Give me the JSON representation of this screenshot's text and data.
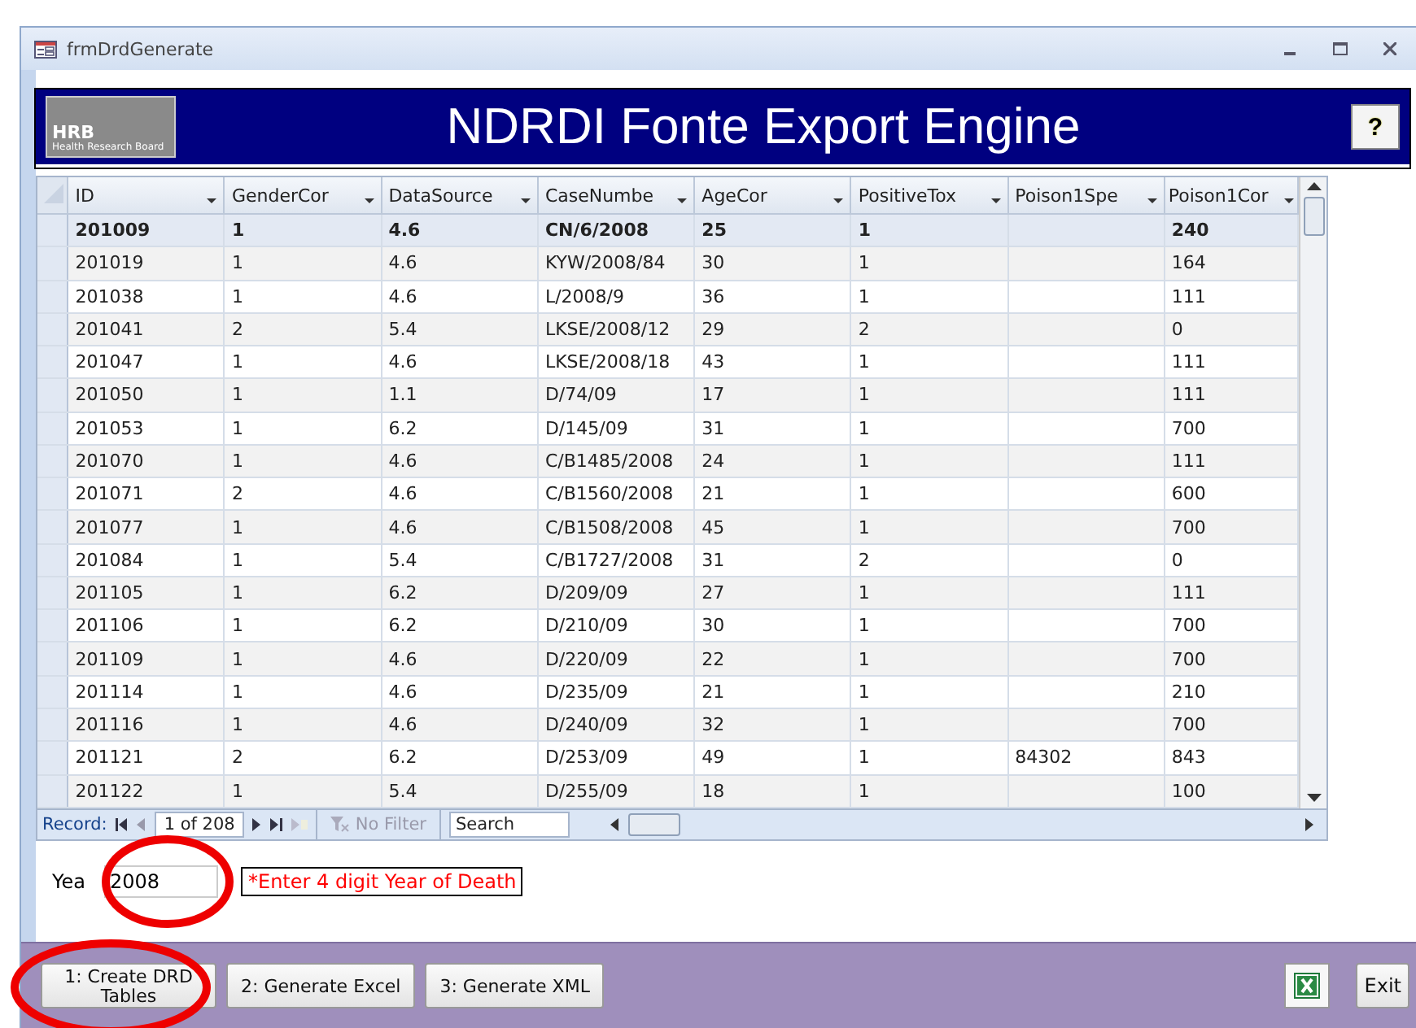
{
  "window": {
    "title": "frmDrdGenerate"
  },
  "header": {
    "logo_text": "HRB",
    "logo_subtext": "Health Research Board",
    "title": "NDRDI Fonte Export Engine",
    "help_button": "?"
  },
  "table": {
    "columns": [
      "ID",
      "GenderCor",
      "DataSource",
      "CaseNumbe",
      "AgeCor",
      "PositiveTox",
      "Poison1Spe",
      "Poison1Cor"
    ],
    "rows": [
      {
        "selected": true,
        "cells": [
          "201009",
          "1",
          "4.6",
          "CN/6/2008",
          "25",
          "1",
          "",
          "240"
        ]
      },
      {
        "selected": false,
        "cells": [
          "201019",
          "1",
          "4.6",
          "KYW/2008/84",
          "30",
          "1",
          "",
          "164"
        ]
      },
      {
        "selected": false,
        "cells": [
          "201038",
          "1",
          "4.6",
          "L/2008/9",
          "36",
          "1",
          "",
          "111"
        ]
      },
      {
        "selected": false,
        "cells": [
          "201041",
          "2",
          "5.4",
          "LKSE/2008/12",
          "29",
          "2",
          "",
          "0"
        ]
      },
      {
        "selected": false,
        "cells": [
          "201047",
          "1",
          "4.6",
          "LKSE/2008/18",
          "43",
          "1",
          "",
          "111"
        ]
      },
      {
        "selected": false,
        "cells": [
          "201050",
          "1",
          "1.1",
          "D/74/09",
          "17",
          "1",
          "",
          "111"
        ]
      },
      {
        "selected": false,
        "cells": [
          "201053",
          "1",
          "6.2",
          "D/145/09",
          "31",
          "1",
          "",
          "700"
        ]
      },
      {
        "selected": false,
        "cells": [
          "201070",
          "1",
          "4.6",
          "C/B1485/2008",
          "24",
          "1",
          "",
          "111"
        ]
      },
      {
        "selected": false,
        "cells": [
          "201071",
          "2",
          "4.6",
          "C/B1560/2008",
          "21",
          "1",
          "",
          "600"
        ]
      },
      {
        "selected": false,
        "cells": [
          "201077",
          "1",
          "4.6",
          "C/B1508/2008",
          "45",
          "1",
          "",
          "700"
        ]
      },
      {
        "selected": false,
        "cells": [
          "201084",
          "1",
          "5.4",
          "C/B1727/2008",
          "31",
          "2",
          "",
          "0"
        ]
      },
      {
        "selected": false,
        "cells": [
          "201105",
          "1",
          "6.2",
          "D/209/09",
          "27",
          "1",
          "",
          "111"
        ]
      },
      {
        "selected": false,
        "cells": [
          "201106",
          "1",
          "6.2",
          "D/210/09",
          "30",
          "1",
          "",
          "700"
        ]
      },
      {
        "selected": false,
        "cells": [
          "201109",
          "1",
          "4.6",
          "D/220/09",
          "22",
          "1",
          "",
          "700"
        ]
      },
      {
        "selected": false,
        "cells": [
          "201114",
          "1",
          "4.6",
          "D/235/09",
          "21",
          "1",
          "",
          "210"
        ]
      },
      {
        "selected": false,
        "cells": [
          "201116",
          "1",
          "4.6",
          "D/240/09",
          "32",
          "1",
          "",
          "700"
        ]
      },
      {
        "selected": false,
        "cells": [
          "201121",
          "2",
          "6.2",
          "D/253/09",
          "49",
          "1",
          "84302",
          "843"
        ]
      },
      {
        "selected": false,
        "cells": [
          "201122",
          "1",
          "5.4",
          "D/255/09",
          "18",
          "1",
          "",
          "100"
        ]
      }
    ]
  },
  "navigation": {
    "label": "Record:",
    "position": "1 of 208",
    "filter": "No Filter",
    "search_placeholder": "Search"
  },
  "year": {
    "label": "Yea",
    "value": "2008",
    "hint": "*Enter 4 digit Year of Death"
  },
  "buttons": [
    {
      "kind": "text",
      "label": "1: Create DRD Tables",
      "circled": true
    },
    {
      "kind": "text",
      "label": "2: Generate Excel",
      "circled": false
    },
    {
      "kind": "text",
      "label": "3: Generate XML",
      "circled": false
    }
  ],
  "right_buttons": [
    {
      "kind": "excel-icon"
    },
    {
      "kind": "text",
      "label": "Exit"
    }
  ]
}
